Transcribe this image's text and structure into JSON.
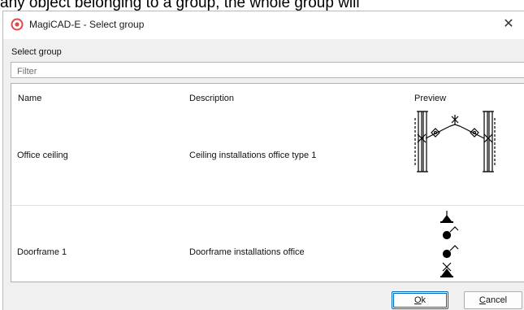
{
  "background_text": "any object belonging to a group, the whole group will",
  "window": {
    "title": "MagiCAD-E - Select group",
    "close_glyph": "✕",
    "icon": "magicad-logo-icon"
  },
  "form": {
    "group_label": "Select group",
    "filter_placeholder": "Filter"
  },
  "table": {
    "columns": [
      "Name",
      "Description",
      "Preview"
    ],
    "rows": [
      {
        "name": "Office ceiling",
        "description": "Ceiling installations office type 1",
        "preview": "office-ceiling-preview-icon"
      },
      {
        "name": "Doorframe 1",
        "description": "Doorframe installations office",
        "preview": "doorframe-preview-icon"
      }
    ]
  },
  "buttons": {
    "ok_mnemonic": "O",
    "ok_rest": "k",
    "cancel_mnemonic": "C",
    "cancel_rest": "ancel"
  },
  "colors": {
    "accent": "#0067c0",
    "app_icon": "#e0484a"
  }
}
